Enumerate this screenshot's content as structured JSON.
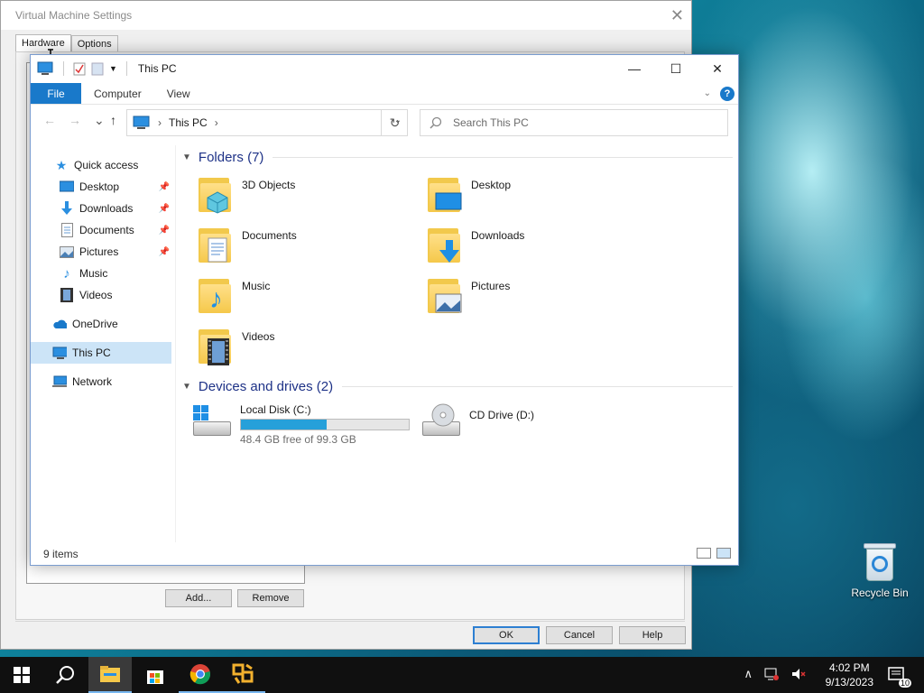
{
  "vm_window": {
    "title": "Virtual Machine Settings",
    "tabs": [
      "Hardware",
      "Options"
    ],
    "buttons": {
      "add": "Add...",
      "remove": "Remove",
      "ok": "OK",
      "cancel": "Cancel",
      "help": "Help"
    }
  },
  "explorer": {
    "title": "This PC",
    "ribbon_tabs": {
      "file": "File",
      "computer": "Computer",
      "view": "View"
    },
    "address": {
      "crumb": "This PC"
    },
    "search": {
      "placeholder": "Search This PC"
    },
    "sidebar": {
      "quick_access": "Quick access",
      "items": [
        {
          "label": "Desktop",
          "pinned": true
        },
        {
          "label": "Downloads",
          "pinned": true
        },
        {
          "label": "Documents",
          "pinned": true
        },
        {
          "label": "Pictures",
          "pinned": true
        },
        {
          "label": "Music",
          "pinned": false
        },
        {
          "label": "Videos",
          "pinned": false
        }
      ],
      "onedrive": "OneDrive",
      "this_pc": "This PC",
      "network": "Network"
    },
    "folders_header": "Folders (7)",
    "folders": [
      "3D Objects",
      "Desktop",
      "Documents",
      "Downloads",
      "Music",
      "Pictures",
      "Videos"
    ],
    "devices_header": "Devices and drives (2)",
    "drives": {
      "c": {
        "name": "Local Disk (C:)",
        "free_text": "48.4 GB free of 99.3 GB",
        "used_fraction": 0.5126
      },
      "d": {
        "name": "CD Drive (D:)"
      }
    },
    "status": "9 items"
  },
  "desktop": {
    "recycle_bin": "Recycle Bin"
  },
  "taskbar": {
    "time": "4:02 PM",
    "date": "9/13/2023",
    "notification_count": "10"
  },
  "colors": {
    "accent": "#1979ca",
    "selection": "#cce4f7",
    "drive_bar": "#26a0da"
  }
}
